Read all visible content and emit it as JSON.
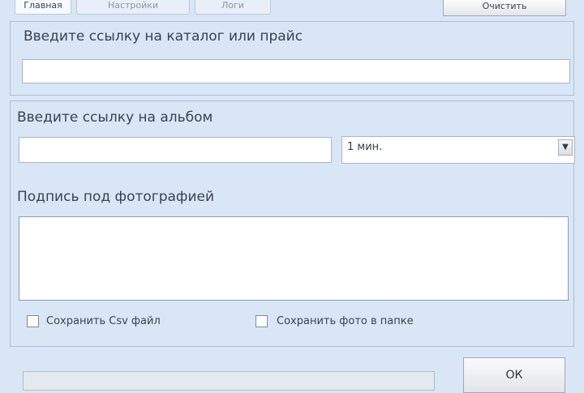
{
  "tabs": [
    {
      "label": "Главная"
    },
    {
      "label": "Настройки"
    },
    {
      "label": "Логи"
    }
  ],
  "top_button": {
    "label": "Очистить"
  },
  "catalog": {
    "label": "Введите ссылку на каталог или прайс",
    "value": ""
  },
  "album": {
    "label": "Введите ссылку на альбом",
    "value": "",
    "select_value": "1 мин."
  },
  "caption": {
    "label": "Подпись под фотографией",
    "value": ""
  },
  "options": {
    "save_csv": {
      "label": "Сохранить Csv файл",
      "checked": false
    },
    "save_photos": {
      "label": "Сохранить фото в папке",
      "checked": false
    }
  },
  "footer": {
    "ok_label": "ОК",
    "progress": 0
  }
}
